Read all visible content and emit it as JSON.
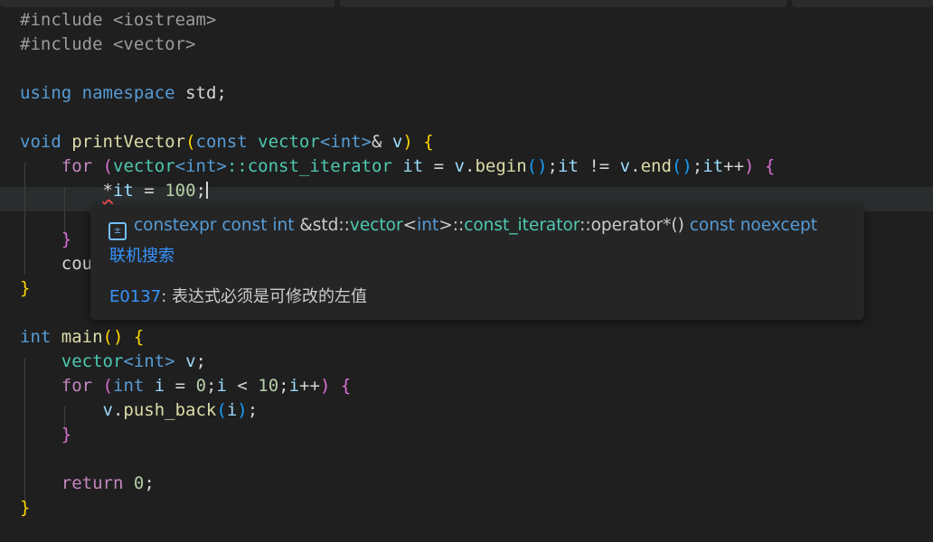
{
  "editor": {
    "lines": {
      "l1": {
        "directive": "#include",
        "header": "<iostream>"
      },
      "l2": {
        "directive": "#include",
        "header": "<vector>"
      },
      "l4": {
        "kw1": "using",
        "kw2": "namespace",
        "ns": "std;"
      },
      "l6": {
        "ret": "void",
        "fname": "printVector",
        "p1": "(",
        "const": "const",
        "type": "vector",
        "targ": "<int>",
        "amp": "&",
        "param": "v",
        "p2": ")",
        "brace": "{"
      },
      "l7": {
        "for": "for",
        "p1": "(",
        "type": "vector",
        "targ": "<int>",
        "scope": "::const_iterator",
        "it": "it",
        "eq": " = ",
        "v": "v",
        "dot": ".",
        "begin": "begin",
        "call": "()",
        "semi": ";",
        "it2": "it",
        "neq": " != ",
        "v2": "v",
        "dot2": ".",
        "end": "end",
        "call2": "()",
        "semi2": ";",
        "it3": "it",
        "inc": "++",
        "p2": ")",
        "brace": "{"
      },
      "l8": {
        "star": "*",
        "it": "it",
        "rest": " = ",
        "num": "100",
        "semi": ";"
      },
      "l10": {
        "brace": "}"
      },
      "l11": {
        "text": "cou"
      },
      "l12": {
        "brace": "}"
      },
      "l14": {
        "ret": "int",
        "fname": "main",
        "parens": "()",
        "brace": "{"
      },
      "l15": {
        "type": "vector",
        "targ": "<int>",
        "var": "v",
        "semi": ";"
      },
      "l16": {
        "for": "for",
        "p1": "(",
        "int": "int",
        "i": "i",
        "eq": " = ",
        "zero": "0",
        "semi": ";",
        "i2": "i",
        "lt": " < ",
        "ten": "10",
        "semi2": ";",
        "i3": "i",
        "inc": "++",
        "p2": ")",
        "brace": "{"
      },
      "l17": {
        "v": "v",
        "dot": ".",
        "fn": "push_back",
        "p1": "(",
        "i": "i",
        "p2": ")",
        "semi": ";"
      },
      "l18": {
        "brace": "}"
      },
      "l20": {
        "ret": "return",
        "zero": "0",
        "semi": ";"
      },
      "l21": {
        "brace": "}"
      }
    }
  },
  "hover": {
    "icon": "symbol-operator-icon",
    "sig": {
      "kw1": "constexpr const int",
      "amp": " &std",
      "sep1": "::",
      "vec": "vector",
      "lt": "<",
      "int": "int",
      "gt": ">",
      "sep2": "::",
      "iter": "const_iterator",
      "sep3": "::",
      "op": "operator*()",
      "kw2": " const noexcept"
    },
    "search_link": "联机搜索",
    "error_code": "E0137",
    "error_text": ": 表达式必须是可修改的左值"
  },
  "colors": {
    "background": "#1f1f1f",
    "hover_bg": "#252526",
    "link": "#3794ff",
    "error_underline": "#f14c4c"
  }
}
